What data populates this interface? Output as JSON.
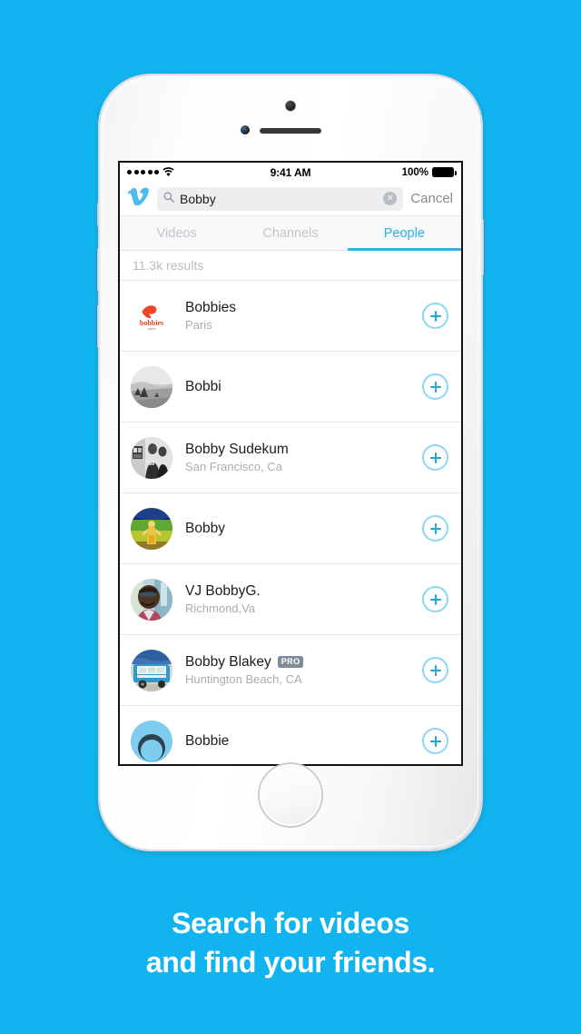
{
  "theme": {
    "background": "#12b4f0",
    "accent": "#26b0e8",
    "follow_ring": "#8dd7f4",
    "follow_plus": "#1fa8e0",
    "pro_badge_bg": "#7e8c99"
  },
  "status_bar": {
    "signal_dots": 5,
    "wifi_icon": "wifi-icon",
    "time": "9:41 AM",
    "battery_percent": "100%",
    "battery_icon": "battery-full-icon"
  },
  "search": {
    "logo_icon": "vimeo-logo-icon",
    "search_icon": "search-icon",
    "value": "Bobby",
    "placeholder": "Search",
    "clear_icon": "clear-circle-icon",
    "clear_glyph": "×",
    "cancel_label": "Cancel"
  },
  "tabs": [
    {
      "label": "Videos",
      "active": false
    },
    {
      "label": "Channels",
      "active": false
    },
    {
      "label": "People",
      "active": true
    }
  ],
  "results": {
    "count_label": "11.3k results"
  },
  "people": [
    {
      "name": "Bobbies",
      "location": "Paris",
      "pro": false,
      "avatar": "logo-bobbies",
      "follow_icon": "plus-circle-icon"
    },
    {
      "name": "Bobbi",
      "location": "",
      "pro": false,
      "avatar": "photo-landscape-bw",
      "follow_icon": "plus-circle-icon"
    },
    {
      "name": "Bobby Sudekum",
      "location": "San Francisco, Ca",
      "pro": false,
      "avatar": "photo-people-bw",
      "follow_icon": "plus-circle-icon"
    },
    {
      "name": "Bobby",
      "location": "",
      "pro": false,
      "avatar": "photo-colorful-figure",
      "follow_icon": "plus-circle-icon"
    },
    {
      "name": "VJ BobbyG.",
      "location": "Richmond,Va",
      "pro": false,
      "avatar": "photo-portrait-teal",
      "follow_icon": "plus-circle-icon"
    },
    {
      "name": "Bobby Blakey",
      "location": "Huntington Beach, CA",
      "pro": true,
      "pro_label": "PRO",
      "avatar": "photo-food-truck",
      "follow_icon": "plus-circle-icon"
    },
    {
      "name": "Bobbie",
      "location": "",
      "pro": false,
      "avatar": "photo-light-blue",
      "follow_icon": "plus-circle-icon"
    }
  ],
  "caption": {
    "line1": "Search for videos",
    "line2": "and find your friends."
  }
}
